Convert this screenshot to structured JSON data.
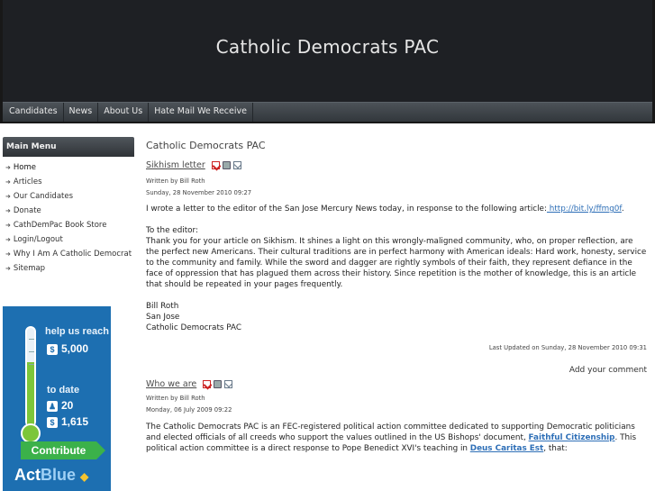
{
  "site": {
    "title": "Catholic Democrats PAC"
  },
  "topnav": [
    "Candidates",
    "News",
    "About Us",
    "Hate Mail We Receive"
  ],
  "sidebar": {
    "menu_title": "Main Menu",
    "items": [
      "Home",
      "Articles",
      "Our Candidates",
      "Donate",
      "CathDemPac Book Store",
      "Login/Logout",
      "Why I Am A Catholic Democrat",
      "Sitemap"
    ]
  },
  "actblue": {
    "help_label": "help us reach",
    "goal": "5,000",
    "to_date_label": "to date",
    "donors": "20",
    "raised": "1,615",
    "contribute_label": "Contribute",
    "logo_act": "Act",
    "logo_blue": "Blue",
    "dollar_symbol": "$",
    "donor_symbol": "♟"
  },
  "content": {
    "heading": "Catholic Democrats PAC",
    "article1": {
      "title": "Sikhism letter",
      "author": "Written by Bill Roth",
      "date": "Sunday, 28 November 2010 09:27",
      "intro": "I wrote a letter to the editor of the San Jose Mercury News today, in response to the following article:",
      "link": " http://bit.ly/ffmg0f",
      "link_after": ".",
      "to_editor": "To the editor:",
      "letter": "Thank you for your article on Sikhism. It shines a light on this wrongly-maligned community, who, on proper reflection, are the perfect new Americans. Their cultural traditions are in perfect harmony with American ideals: Hard work, honesty, service to the community and family. While the sword and dagger are rightly symbols of their faith, they represent defiance in the face of oppression that has plagued them across their history. Since repetition is the mother of knowledge, this is an article that should be repeated in your pages frequently.",
      "sign_name": "Bill Roth",
      "sign_city": "San Jose",
      "sign_org": "Catholic Democrats PAC",
      "updated": "Last Updated on Sunday, 28 November 2010 09:31"
    },
    "add_comment": "Add your comment",
    "article2": {
      "title": "Who we are",
      "author": "Written by Bill Roth",
      "date": "Monday, 06 July 2009 09:22",
      "text_a": "The Catholic Democrats PAC is an FEC-registered political action committee dedicated to supporting Democratic politicians and elected officials of all creeds who support the values outlined in the US Bishops' document, ",
      "link_a": "Faithful Citizenship",
      "text_b": ". This political action committee is a direct response to Pope Benedict XVI's teaching in ",
      "link_b": "Deus Caritas Est",
      "text_c": ", that:"
    }
  }
}
